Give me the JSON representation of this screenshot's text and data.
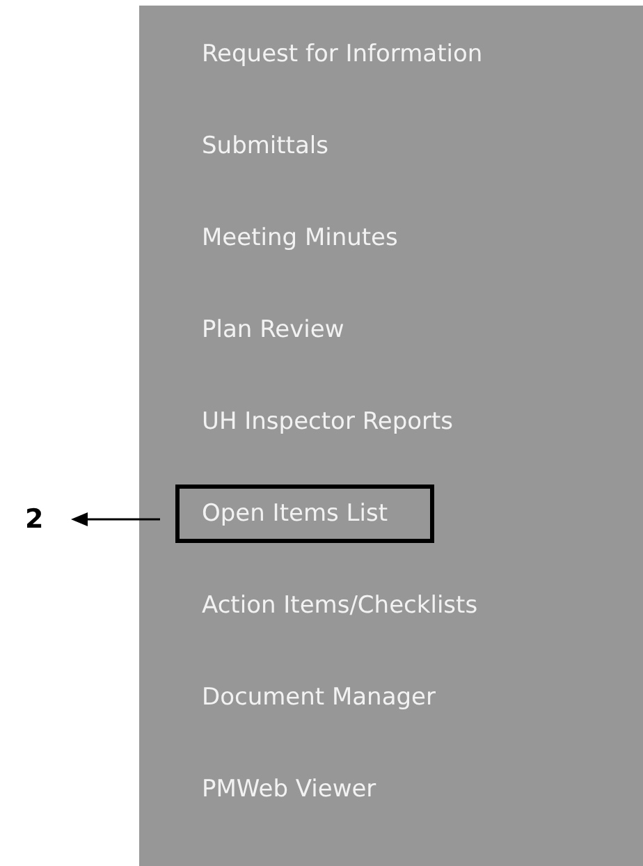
{
  "menu": {
    "items": [
      {
        "label": "Request for Information",
        "annotated": false
      },
      {
        "label": "Submittals",
        "annotated": false
      },
      {
        "label": "Meeting Minutes",
        "annotated": false
      },
      {
        "label": "Plan Review",
        "annotated": false
      },
      {
        "label": "UH Inspector Reports",
        "annotated": false
      },
      {
        "label": "Open Items List",
        "annotated": true
      },
      {
        "label": "Action Items/Checklists",
        "annotated": false
      },
      {
        "label": "Document Manager",
        "annotated": false
      },
      {
        "label": "PMWeb Viewer",
        "annotated": false
      }
    ]
  },
  "annotation": {
    "label": "2"
  }
}
